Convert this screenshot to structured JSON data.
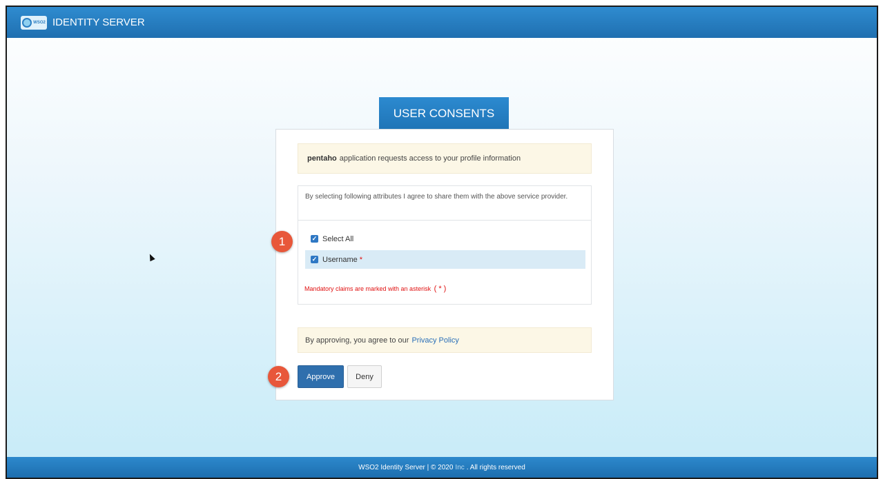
{
  "header": {
    "logo_text": "WSO2",
    "title": "IDENTITY SERVER"
  },
  "consent": {
    "tab_title": "USER CONSENTS",
    "app_name": "pentaho",
    "request_text": "application requests access to your profile information",
    "attributes_description": "By selecting following attributes I agree to share them with the above service provider.",
    "select_all_label": "Select All",
    "username_label": "Username",
    "required_marker": "*",
    "mandatory_note": "Mandatory claims are marked with an asterisk",
    "mandatory_marker": "( * )",
    "policy_prefix": "By approving, you agree to our",
    "policy_link": "Privacy Policy",
    "approve_label": "Approve",
    "deny_label": "Deny"
  },
  "annotations": {
    "step1": "1",
    "step2": "2"
  },
  "footer": {
    "product": "WSO2 Identity Server | © 2020",
    "company": "Inc",
    "rights": ". All rights reserved"
  },
  "colors": {
    "primary": "#2f78c4",
    "header_blue": "#1f6fb0",
    "notice_bg": "#fcf7e6",
    "required_red": "#e01010",
    "step_badge": "#e8573a"
  }
}
